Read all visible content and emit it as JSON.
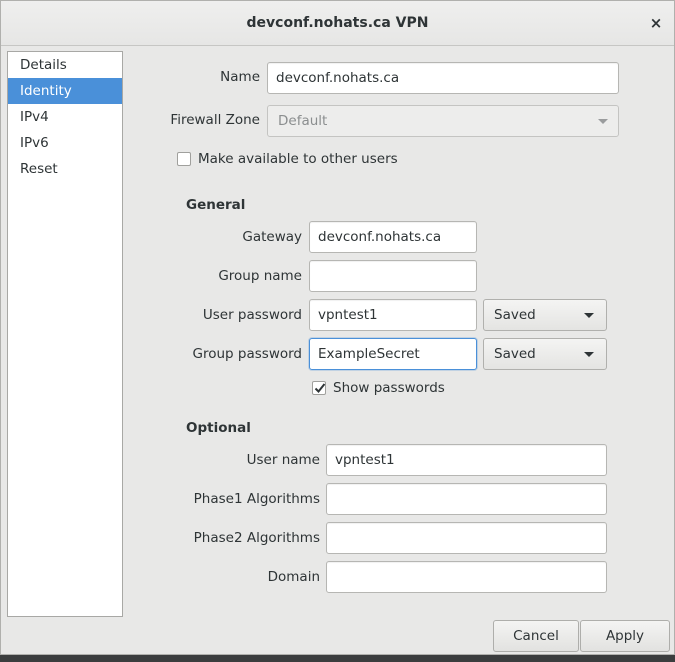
{
  "window": {
    "title": "devconf.nohats.ca VPN",
    "close_icon": "×"
  },
  "sidebar": {
    "items": [
      {
        "label": "Details",
        "selected": false
      },
      {
        "label": "Identity",
        "selected": true
      },
      {
        "label": "IPv4",
        "selected": false
      },
      {
        "label": "IPv6",
        "selected": false
      },
      {
        "label": "Reset",
        "selected": false
      }
    ]
  },
  "identity": {
    "name_label": "Name",
    "name_value": "devconf.nohats.ca",
    "firewall_label": "Firewall Zone",
    "firewall_value": "Default",
    "share_label": "Make available to other users",
    "share_checked": false
  },
  "general": {
    "heading": "General",
    "gateway_label": "Gateway",
    "gateway_value": "devconf.nohats.ca",
    "group_name_label": "Group name",
    "group_name_value": "",
    "user_password_label": "User password",
    "user_password_value": "vpntest1",
    "user_password_mode": "Saved",
    "group_password_label": "Group password",
    "group_password_value": "ExampleSecret",
    "group_password_mode": "Saved",
    "show_passwords_label": "Show passwords",
    "show_passwords_checked": true
  },
  "optional": {
    "heading": "Optional",
    "user_name_label": "User name",
    "user_name_value": "vpntest1",
    "phase1_label": "Phase1 Algorithms",
    "phase1_value": "",
    "phase2_label": "Phase2 Algorithms",
    "phase2_value": "",
    "domain_label": "Domain",
    "domain_value": ""
  },
  "actions": {
    "cancel_label": "Cancel",
    "apply_label": "Apply"
  },
  "colors": {
    "selection": "#4a90d9",
    "focus_border": "#4a90d9"
  }
}
